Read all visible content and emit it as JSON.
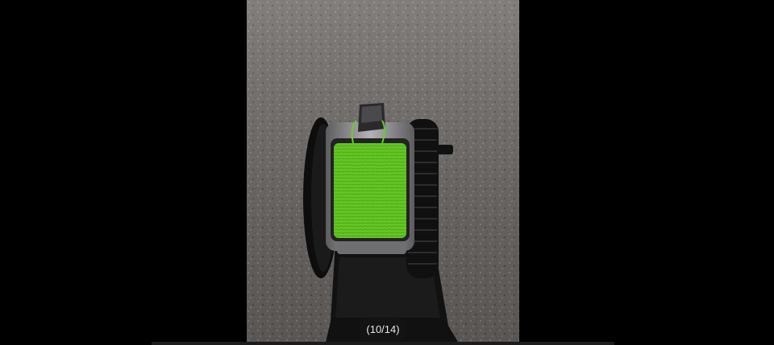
{
  "viewer": {
    "counter_text": "(10/14)",
    "current_index": 10,
    "total_images": 14
  },
  "photo": {
    "icon": "fly-fishing-reel-photo",
    "colors": {
      "background": "#000000",
      "countertop": "#6a6664",
      "line": "#5fc321",
      "reel_black": "#0f0f10",
      "frame_silver": "#8d8d90"
    }
  }
}
